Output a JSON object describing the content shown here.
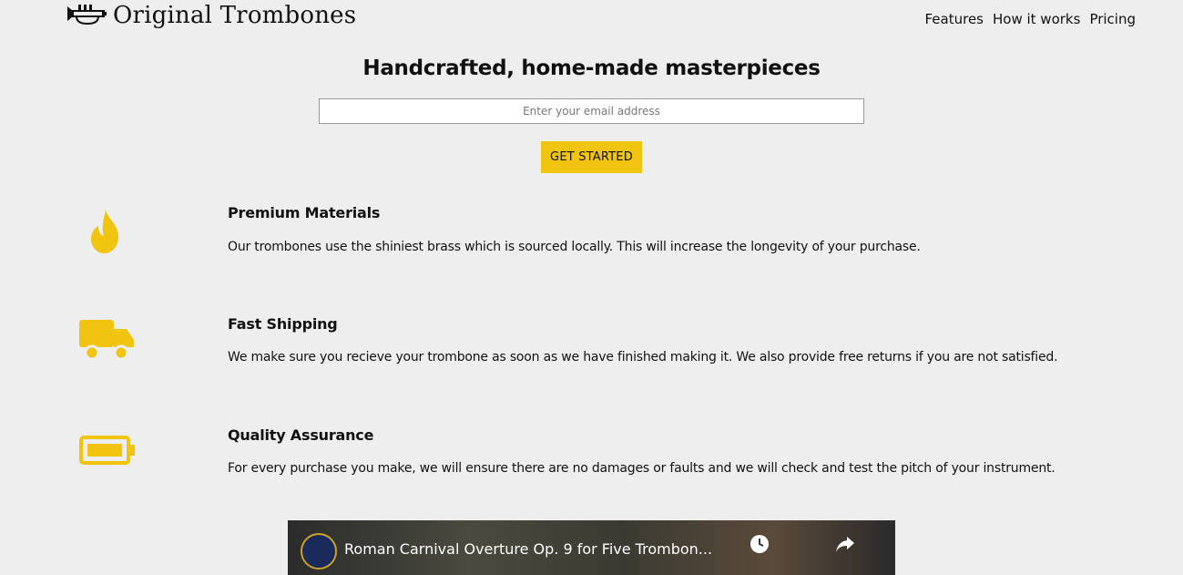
{
  "brand": {
    "name": "Original Trombones",
    "accent_color": "#f1c40f"
  },
  "nav": {
    "items": [
      {
        "label": "Features"
      },
      {
        "label": "How it works"
      },
      {
        "label": "Pricing"
      }
    ]
  },
  "hero": {
    "title": "Handcrafted, home-made masterpieces",
    "email_placeholder": "Enter your email address",
    "cta_label": "GET STARTED"
  },
  "features": [
    {
      "icon": "fire-icon",
      "title": "Premium Materials",
      "text": "Our trombones use the shiniest brass which is sourced locally. This will increase the longevity of your purchase."
    },
    {
      "icon": "truck-icon",
      "title": "Fast Shipping",
      "text": "We make sure you recieve your trombone as soon as we have finished making it. We also provide free returns if you are not satisfied."
    },
    {
      "icon": "battery-full-icon",
      "title": "Quality Assurance",
      "text": "For every purchase you make, we will ensure there are no damages or faults and we will check and test the pitch of your instrument."
    }
  ],
  "video": {
    "title": "Roman Carnival Overture Op. 9 for Five Trombon...",
    "icons": [
      "watch-later-icon",
      "share-icon"
    ]
  }
}
